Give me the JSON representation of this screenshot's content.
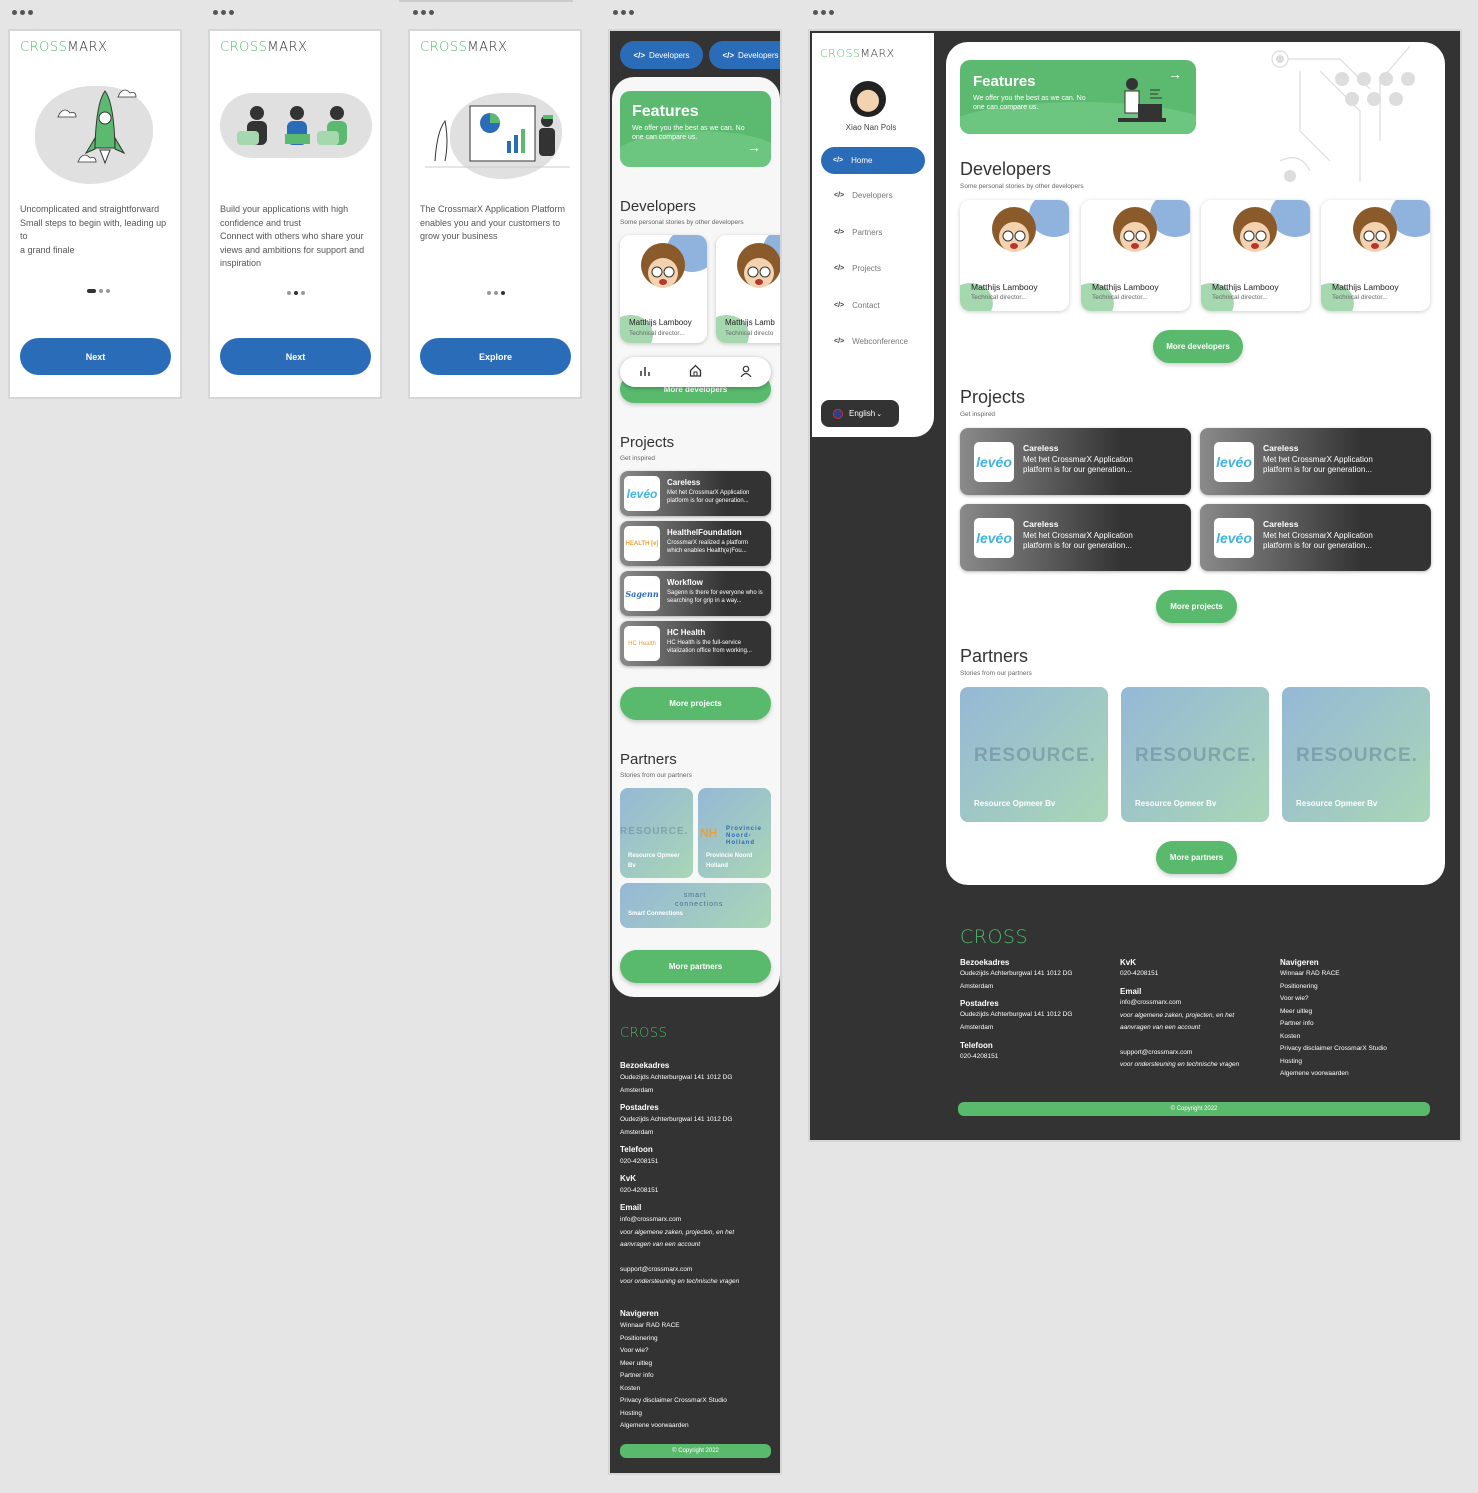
{
  "brand": {
    "logo_cross": "CROSS",
    "logo_marx": "MARX"
  },
  "onboarding": [
    {
      "text": [
        "Uncomplicated and straightforward",
        "Small steps to begin with, leading up to",
        "a grand finale"
      ],
      "button": "Next"
    },
    {
      "text": [
        "Build your applications with high",
        "confidence and trust",
        "Connect with others who share your",
        "views and ambitions for support and",
        "inspiration"
      ],
      "button": "Next"
    },
    {
      "text": [
        "The CrossmarX Application Platform",
        "enables you and your customers to",
        "grow your business"
      ],
      "button": "Explore"
    }
  ],
  "mobile": {
    "top_chips": [
      "Developers",
      "Developers"
    ],
    "features": {
      "title": "Features",
      "text": "We offer you the best as we can. No one can compare us."
    },
    "developers": {
      "title": "Developers",
      "subtitle": "Some personal stories by other developers",
      "cards": [
        {
          "name": "Matthijs Lambooy",
          "role": "Technical director..."
        },
        {
          "name": "Matthijs Lamb",
          "role": "Technical directo"
        }
      ],
      "more": "More developers"
    },
    "projects": {
      "title": "Projects",
      "subtitle": "Get inspired",
      "items": [
        {
          "logo": "levéo",
          "title": "Careless",
          "desc": "Met het CrossmarX Application platform is for our generation..."
        },
        {
          "logo": "HEALTH [e]",
          "title": "HealthelFoundation",
          "desc": "CrossmarX realized a platform which enables Health(e)Fou..."
        },
        {
          "logo": "Sagenn",
          "title": "Workflow",
          "desc": "Sagenn is there for everyone who is searching for grip in a way..."
        },
        {
          "logo": "HC Health",
          "title": "HC Health",
          "desc": "HC Health is the full-service vitalization office from working..."
        }
      ],
      "more": "More projects"
    },
    "partners": {
      "title": "Partners",
      "subtitle": "Stories from our partners",
      "items": [
        {
          "wm": "RESOURCE.",
          "name": "Resource Opmeer Bv"
        },
        {
          "wm": "Provincie Noord-Holland",
          "name": "Provincie Noord Holland"
        },
        {
          "wm": "smart connections",
          "name": "Smart Connections"
        }
      ],
      "more": "More partners"
    },
    "footer": {
      "logo": "CROSS",
      "visit_h": "Bezoekadres",
      "visit": [
        "Oudezijds Achterburgwal 141 1012 DG",
        "Amsterdam"
      ],
      "post_h": "Postadres",
      "post": [
        "Oudezijds Achterburgwal 141 1012 DG",
        "Amsterdam"
      ],
      "tel_h": "Telefoon",
      "tel": "020-4208151",
      "kvk_h": "KvK",
      "kvk": "020-4208151",
      "email_h": "Email",
      "email1": "info@crossmarx.com",
      "email1_note": [
        "voor algemene zaken, projecten, en het",
        "aanvragen van een account"
      ],
      "email2": "support@crossmarx.com",
      "email2_note": "voor ondersteuning en technische vragen",
      "nav_h": "Navigeren",
      "nav": [
        "Winnaar RAD RACE",
        "Positionering",
        "Voor wie?",
        "Meer uitleg",
        "Partner info",
        "Kosten",
        "Privacy disclaimer CrossmarX Studio",
        "Hosting",
        "Algemene voorwaarden"
      ],
      "copyright": "© Copyright 2022"
    }
  },
  "desktop": {
    "user": "Xiao Nan Pols",
    "nav": [
      "Home",
      "Developers",
      "Partners",
      "Projects",
      "Contact",
      "Webconference"
    ],
    "language": "English",
    "features": {
      "title": "Features",
      "text": "We offer you the best as we can. No one can compare us."
    },
    "developers": {
      "title": "Developers",
      "subtitle": "Some personal stories by other developers",
      "name": "Matthijs Lambooy",
      "role": "Technical director...",
      "more": "More developers"
    },
    "projects": {
      "title": "Projects",
      "subtitle": "Get inspired",
      "logo": "levéo",
      "item_title": "Careless",
      "item_desc": "Met het CrossmarX Application platform is for our generation...",
      "more": "More projects"
    },
    "partners": {
      "title": "Partners",
      "subtitle": "Stories from our partners",
      "wm": "RESOURCE.",
      "name": "Resource Opmeer Bv",
      "more": "More partners"
    }
  },
  "colors": {
    "green": "#59b96c",
    "blue": "#2b6cb8",
    "dark": "#333333"
  }
}
